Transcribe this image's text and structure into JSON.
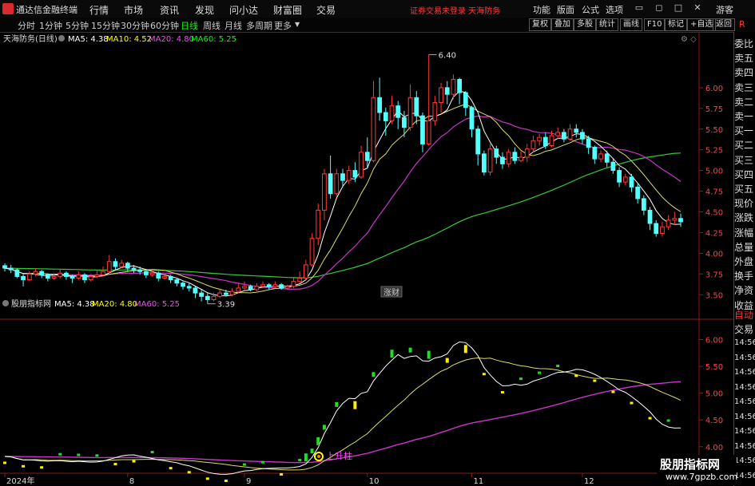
{
  "titlebar": {
    "app_title": "通达信金融终端",
    "menus": [
      "行情",
      "市场",
      "资讯",
      "发现",
      "问小达",
      "财富圈",
      "交易"
    ],
    "notice": "证券交易未登录  天海防务",
    "right_menus": [
      "功能",
      "版面",
      "公式",
      "选项"
    ],
    "guest": "游客"
  },
  "toolbar": {
    "timeframes": [
      "分时",
      "1分钟",
      "5分钟",
      "15分钟",
      "30分钟",
      "60分钟",
      "日线",
      "周线",
      "月线",
      "多周期",
      "更多"
    ],
    "active_timeframe": "日线",
    "buttons": [
      "复权",
      "叠加",
      "多股",
      "统计",
      "画线",
      "F10",
      "标记",
      "+自选",
      "返回"
    ]
  },
  "main_chart": {
    "legend_name": "天海防务(日线)",
    "ma5": "MA5: 4.38",
    "ma10": "MA10: 4.52",
    "ma20": "MA20: 4.80",
    "ma60": "MA60: 5.25",
    "high_label": "6.40",
    "low_label": "3.39",
    "badge": "涨财"
  },
  "sub_chart": {
    "legend_name": "股朋指标网",
    "ma5": "MA5: 4.38",
    "ma20": "MA20: 4.80",
    "ma60": "MA60: 5.25",
    "signal_label": "上升柱"
  },
  "colors": {
    "up": "#ff3a3a",
    "down": "#54ffff",
    "ma5": "#ffffff",
    "ma10": "#ffff00",
    "ma20": "#ff44ff",
    "ma60": "#00ff00",
    "ma60_line": "#33cc33",
    "ma20_line": "#cc33cc",
    "ma10_line": "#dddd66"
  },
  "chart_data": [
    {
      "type": "candlestick",
      "title": "天海防务(日线)",
      "y_ticks": [
        3.5,
        3.75,
        4.0,
        4.25,
        4.5,
        4.75,
        5.0,
        5.25,
        5.5,
        5.75,
        6.0
      ],
      "ylim": [
        3.3,
        6.5
      ],
      "x_labels": [
        "2024年",
        "8",
        "9",
        "10",
        "11",
        "12",
        "1"
      ],
      "annotations": {
        "high": 6.4,
        "low": 3.39
      },
      "candles": [
        [
          3.85,
          3.82,
          3.88,
          3.78
        ],
        [
          3.82,
          3.8,
          3.86,
          3.76
        ],
        [
          3.8,
          3.72,
          3.82,
          3.7
        ],
        [
          3.72,
          3.68,
          3.76,
          3.6
        ],
        [
          3.68,
          3.75,
          3.78,
          3.66
        ],
        [
          3.75,
          3.78,
          3.82,
          3.72
        ],
        [
          3.78,
          3.74,
          3.8,
          3.7
        ],
        [
          3.74,
          3.7,
          3.76,
          3.66
        ],
        [
          3.7,
          3.72,
          3.76,
          3.68
        ],
        [
          3.72,
          3.76,
          3.8,
          3.7
        ],
        [
          3.76,
          3.72,
          3.78,
          3.68
        ],
        [
          3.72,
          3.7,
          3.74,
          3.64
        ],
        [
          3.7,
          3.74,
          3.78,
          3.68
        ],
        [
          3.74,
          3.68,
          3.76,
          3.64
        ],
        [
          3.68,
          3.72,
          3.75,
          3.66
        ],
        [
          3.72,
          3.74,
          3.8,
          3.7
        ],
        [
          3.74,
          3.78,
          3.84,
          3.72
        ],
        [
          3.78,
          3.9,
          3.98,
          3.76
        ],
        [
          3.9,
          3.84,
          3.94,
          3.8
        ],
        [
          3.84,
          3.88,
          3.92,
          3.82
        ],
        [
          3.88,
          3.82,
          3.9,
          3.78
        ],
        [
          3.82,
          3.8,
          3.86,
          3.76
        ],
        [
          3.8,
          3.78,
          3.84,
          3.74
        ],
        [
          3.78,
          3.74,
          3.8,
          3.7
        ],
        [
          3.74,
          3.76,
          3.8,
          3.72
        ],
        [
          3.76,
          3.7,
          3.78,
          3.66
        ],
        [
          3.7,
          3.72,
          3.76,
          3.68
        ],
        [
          3.72,
          3.68,
          3.74,
          3.64
        ],
        [
          3.68,
          3.64,
          3.7,
          3.6
        ],
        [
          3.64,
          3.6,
          3.66,
          3.56
        ],
        [
          3.6,
          3.58,
          3.64,
          3.54
        ],
        [
          3.58,
          3.52,
          3.6,
          3.46
        ],
        [
          3.52,
          3.48,
          3.56,
          3.42
        ],
        [
          3.48,
          3.44,
          3.52,
          3.39
        ],
        [
          3.44,
          3.48,
          3.52,
          3.42
        ],
        [
          3.48,
          3.52,
          3.56,
          3.46
        ],
        [
          3.52,
          3.5,
          3.56,
          3.48
        ],
        [
          3.5,
          3.54,
          3.58,
          3.48
        ],
        [
          3.54,
          3.58,
          3.64,
          3.52
        ],
        [
          3.58,
          3.6,
          3.66,
          3.56
        ],
        [
          3.6,
          3.56,
          3.62,
          3.54
        ],
        [
          3.56,
          3.6,
          3.64,
          3.54
        ],
        [
          3.6,
          3.62,
          3.66,
          3.58
        ],
        [
          3.62,
          3.6,
          3.64,
          3.56
        ],
        [
          3.6,
          3.62,
          3.66,
          3.58
        ],
        [
          3.62,
          3.58,
          3.64,
          3.56
        ],
        [
          3.58,
          3.6,
          3.62,
          3.56
        ],
        [
          3.6,
          3.66,
          3.7,
          3.58
        ],
        [
          3.66,
          3.7,
          3.78,
          3.64
        ],
        [
          3.7,
          3.86,
          3.92,
          3.68
        ],
        [
          3.86,
          4.18,
          4.24,
          3.84
        ],
        [
          4.18,
          4.52,
          4.6,
          4.1
        ],
        [
          4.52,
          4.96,
          5.02,
          4.4
        ],
        [
          4.96,
          4.72,
          5.18,
          4.66
        ],
        [
          4.72,
          4.96,
          5.02,
          4.68
        ],
        [
          4.96,
          4.88,
          5.02,
          4.8
        ],
        [
          4.88,
          5.0,
          5.06,
          4.84
        ],
        [
          5.0,
          4.92,
          5.1,
          4.86
        ],
        [
          4.92,
          5.22,
          5.3,
          4.9
        ],
        [
          5.22,
          5.12,
          5.4,
          5.04
        ],
        [
          5.12,
          5.88,
          6.08,
          5.1
        ],
        [
          5.88,
          5.7,
          6.12,
          5.6
        ],
        [
          5.7,
          5.6,
          5.76,
          5.42
        ],
        [
          5.6,
          5.78,
          5.9,
          5.56
        ],
        [
          5.78,
          5.64,
          5.84,
          5.5
        ],
        [
          5.64,
          5.52,
          5.72,
          5.4
        ],
        [
          5.52,
          5.88,
          6.04,
          5.48
        ],
        [
          5.88,
          5.66,
          5.96,
          5.56
        ],
        [
          5.66,
          5.32,
          5.7,
          5.22
        ],
        [
          5.32,
          5.6,
          6.4,
          5.3
        ],
        [
          5.6,
          5.82,
          5.9,
          5.54
        ],
        [
          5.82,
          6.0,
          6.06,
          5.7
        ],
        [
          6.0,
          5.92,
          6.08,
          5.8
        ],
        [
          5.92,
          6.1,
          6.16,
          5.86
        ],
        [
          6.1,
          5.94,
          6.12,
          5.8
        ],
        [
          5.94,
          5.76,
          5.96,
          5.66
        ],
        [
          5.76,
          5.5,
          5.78,
          5.4
        ],
        [
          5.5,
          5.2,
          5.54,
          5.06
        ],
        [
          5.2,
          4.98,
          5.24,
          4.94
        ],
        [
          4.98,
          5.26,
          5.32,
          4.94
        ],
        [
          5.26,
          5.16,
          5.3,
          5.08
        ],
        [
          5.16,
          5.08,
          5.22,
          5.02
        ],
        [
          5.08,
          5.22,
          5.26,
          5.04
        ],
        [
          5.22,
          5.12,
          5.28,
          5.08
        ],
        [
          5.12,
          5.16,
          5.24,
          5.1
        ],
        [
          5.16,
          5.26,
          5.32,
          5.1
        ],
        [
          5.26,
          5.36,
          5.42,
          5.22
        ],
        [
          5.36,
          5.4,
          5.44,
          5.3
        ],
        [
          5.4,
          5.3,
          5.46,
          5.26
        ],
        [
          5.3,
          5.42,
          5.48,
          5.28
        ],
        [
          5.42,
          5.46,
          5.52,
          5.38
        ],
        [
          5.46,
          5.38,
          5.5,
          5.34
        ],
        [
          5.38,
          5.5,
          5.56,
          5.36
        ],
        [
          5.5,
          5.46,
          5.56,
          5.4
        ],
        [
          5.46,
          5.38,
          5.5,
          5.32
        ],
        [
          5.38,
          5.28,
          5.42,
          5.2
        ],
        [
          5.28,
          5.14,
          5.3,
          5.08
        ],
        [
          5.14,
          5.2,
          5.24,
          5.1
        ],
        [
          5.2,
          5.1,
          5.24,
          5.04
        ],
        [
          5.1,
          5.0,
          5.14,
          4.96
        ],
        [
          5.0,
          4.86,
          5.04,
          4.8
        ],
        [
          4.86,
          4.92,
          4.96,
          4.82
        ],
        [
          4.92,
          4.8,
          4.96,
          4.74
        ],
        [
          4.8,
          4.66,
          4.84,
          4.6
        ],
        [
          4.66,
          4.52,
          4.7,
          4.46
        ],
        [
          4.52,
          4.36,
          4.56,
          4.28
        ],
        [
          4.36,
          4.24,
          4.4,
          4.2
        ],
        [
          4.24,
          4.32,
          4.38,
          4.2
        ],
        [
          4.32,
          4.4,
          4.46,
          4.28
        ],
        [
          4.4,
          4.42,
          4.5,
          4.34
        ],
        [
          4.42,
          4.38,
          4.48,
          4.32
        ]
      ]
    },
    {
      "type": "line",
      "title": "股朋指标网",
      "y_ticks": [
        4.0,
        4.5,
        5.0,
        5.5,
        6.0
      ],
      "ylim": [
        3.55,
        6.35
      ],
      "series": [
        {
          "name": "MA5"
        },
        {
          "name": "MA20"
        },
        {
          "name": "MA60"
        }
      ]
    }
  ],
  "right_panel": {
    "labels": [
      "委比",
      "卖五",
      "卖四",
      "卖三",
      "卖二",
      "卖一",
      "买一",
      "买二",
      "买三",
      "买四",
      "买五",
      "现价",
      "涨跌",
      "涨幅",
      "总量",
      "外盘",
      "换手",
      "净资",
      "收益"
    ],
    "tabs": [
      "自动",
      "交易"
    ],
    "times": [
      "14:56",
      "14:56",
      "14:56",
      "14:56",
      "14:56",
      "14:56",
      "14:56",
      "14:56",
      "14:56",
      "14:56"
    ]
  },
  "watermark": {
    "line1": "股朋指标网",
    "line2": "www.7gpzb.com"
  }
}
